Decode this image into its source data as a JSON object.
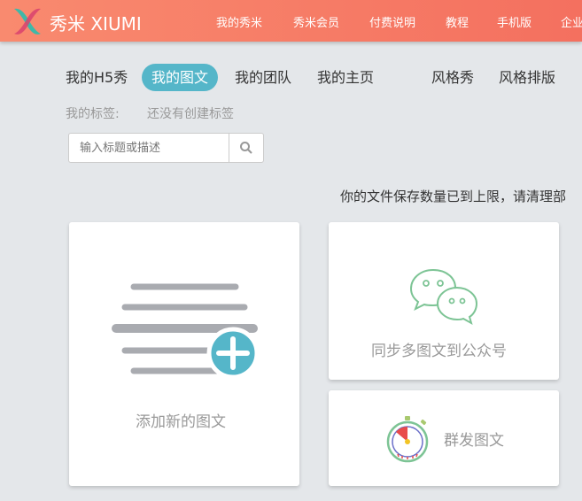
{
  "header": {
    "brand": "秀米 XIUMI",
    "nav": [
      "我的秀米",
      "秀米会员",
      "付费说明",
      "教程",
      "手机版",
      "企业"
    ]
  },
  "tabs": [
    {
      "label": "我的H5秀"
    },
    {
      "label": "我的图文",
      "active": true
    },
    {
      "label": "我的团队"
    },
    {
      "label": "我的主页"
    },
    {
      "label": "风格秀"
    },
    {
      "label": "风格排版"
    }
  ],
  "tags": {
    "label": "我的标签:",
    "empty": "还没有创建标签"
  },
  "search": {
    "placeholder": "输入标题或描述"
  },
  "notice": "你的文件保存数量已到上限，请清理部",
  "cards": {
    "add": "添加新的图文",
    "sync": "同步多图文到公众号",
    "mass": "群发图文"
  },
  "colors": {
    "header": "#f4705f",
    "accent": "#55b6c9",
    "wechat": "#7dc495"
  }
}
